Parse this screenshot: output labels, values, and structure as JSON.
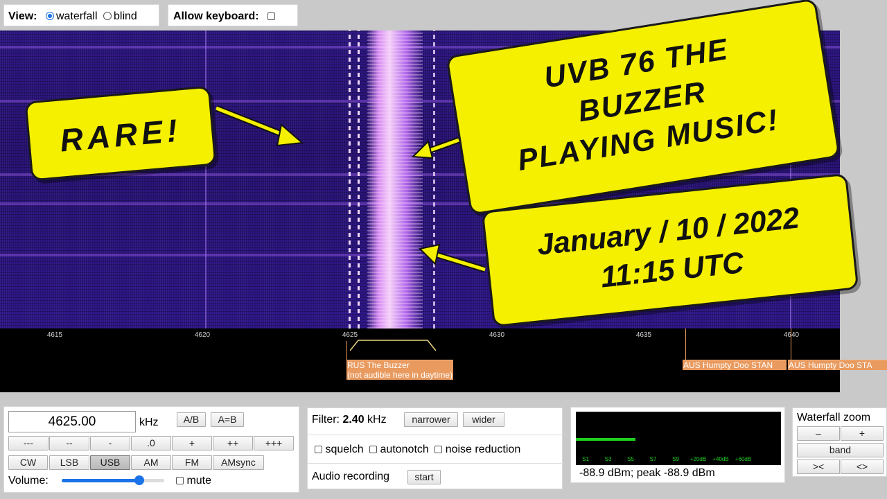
{
  "top": {
    "view_label": "View:",
    "view_options": [
      "waterfall",
      "blind"
    ],
    "view_selected": "waterfall",
    "keyboard_label": "Allow keyboard:"
  },
  "scale": {
    "ticks": [
      "4615",
      "4620",
      "4625",
      "4630",
      "4635",
      "4640"
    ],
    "stations": [
      {
        "line1": "RUS The Buzzer",
        "line2": "(not audible here in daytime)"
      },
      {
        "line1": "AUS Humpty Doo STAN"
      },
      {
        "line1": "AUS Humpty Doo STA"
      }
    ]
  },
  "tuning": {
    "frequency": "4625.00",
    "unit": "kHz",
    "ab_buttons": [
      "A/B",
      "A=B"
    ],
    "step_buttons": [
      "---",
      "--",
      "-",
      ".0",
      "+",
      "++",
      "+++"
    ],
    "modes": [
      "CW",
      "LSB",
      "USB",
      "AM",
      "FM",
      "AMsync"
    ],
    "selected_mode": "USB",
    "volume_label": "Volume:",
    "volume_level": 0.76,
    "mute_label": "mute"
  },
  "filter": {
    "label": "Filter:",
    "value": "2.40",
    "unit": "kHz",
    "narrower": "narrower",
    "wider": "wider",
    "options": [
      "squelch",
      "autonotch",
      "noise reduction"
    ],
    "recording_label": "Audio recording",
    "start": "start"
  },
  "smeter": {
    "scale": [
      "S1",
      "S3",
      "S5",
      "S7",
      "S9",
      "+20dB",
      "+40dB",
      "+60dB"
    ],
    "level": 0.29,
    "readout": "-88.9 dBm; peak  -88.9 dBm"
  },
  "zoom": {
    "title": "Waterfall zoom",
    "buttons": [
      "–",
      "+",
      "band",
      "><",
      "<>"
    ]
  },
  "overlays": {
    "rare": "RARE!",
    "title_lines": [
      "UVB 76 THE",
      "BUZZER",
      "PLAYING MUSIC!"
    ],
    "date_lines": [
      "January / 10 / 2022",
      "11:15 UTC"
    ]
  },
  "colors": {
    "waterfall": "#2a147e",
    "callout": "#f5f000",
    "station_label": "#e89a5f",
    "meter": "#20d020",
    "accent": "#1a73e8"
  }
}
